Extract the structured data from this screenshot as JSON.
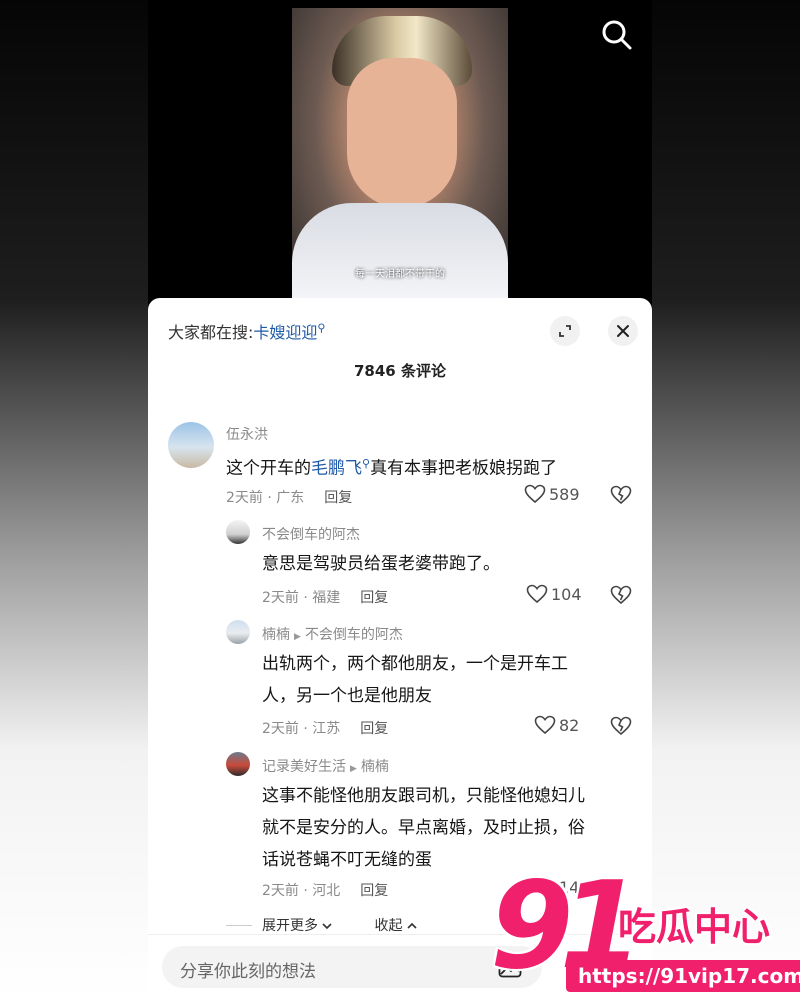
{
  "video": {
    "subtitle": "每一天泪都不带干的"
  },
  "header": {
    "hot_search_prefix": "大家都在搜:",
    "hot_search_keyword": "卡嫂迎迎",
    "search_glyph": "⚲"
  },
  "comment_count": "7846 条评论",
  "comments": [
    {
      "name": "伍永洪",
      "text_before": "这个开车的",
      "keyword": "毛鹏飞",
      "text_after": "真有本事把老板娘拐跑了",
      "time_location": "2天前 · 广东",
      "reply_label": "回复",
      "likes": "589"
    },
    {
      "name": "不会倒车的阿杰",
      "text": "意思是驾驶员给蛋老婆带跑了。",
      "time_location": "2天前 · 福建",
      "reply_label": "回复",
      "likes": "104"
    },
    {
      "name": "楠楠",
      "reply_to": "不会倒车的阿杰",
      "text_line1": "出轨两个，两个都他朋友，一个是开车工",
      "text_line2": "人，另一个也是他朋友",
      "time_location": "2天前 · 江苏",
      "reply_label": "回复",
      "likes": "82"
    },
    {
      "name": "记录美好生活",
      "reply_to": "楠楠",
      "text_line1": "这事不能怪他朋友跟司机，只能怪他媳妇儿",
      "text_line2": "就不是安分的人。早点离婚，及时止损，俗",
      "text_line3": "话说苍蝇不叮无缝的蛋",
      "time_location": "2天前 · 河北",
      "reply_label": "回复",
      "likes": "14"
    }
  ],
  "expand_label": "展开更多",
  "collapse_label": "收起",
  "input_placeholder": "分享你此刻的想法",
  "watermark": {
    "number": "91",
    "name": "吃瓜中心",
    "url": "https://91vip17.com"
  },
  "colors": {
    "accent_link": "#1f5aa8",
    "watermark": "#f0206c"
  },
  "icons": [
    "search-icon",
    "expand-icon",
    "close-icon",
    "heart-icon",
    "broken-heart-icon",
    "image-icon",
    "chevron-down-icon",
    "chevron-up-icon"
  ]
}
